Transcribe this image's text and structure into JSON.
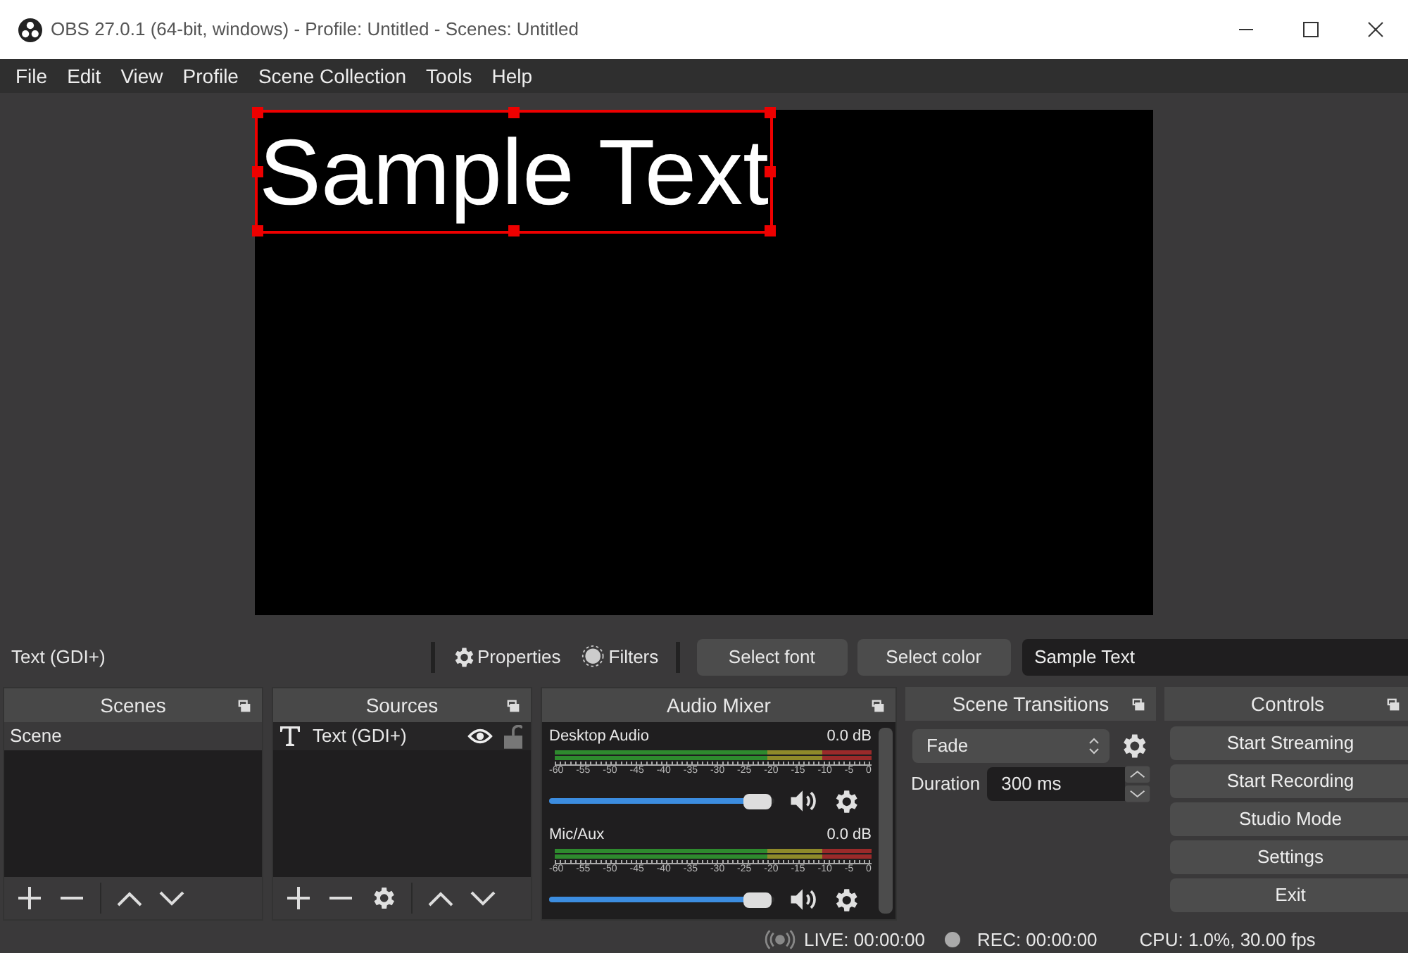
{
  "window": {
    "title": "OBS 27.0.1 (64-bit, windows) - Profile: Untitled - Scenes: Untitled"
  },
  "menu": [
    "File",
    "Edit",
    "View",
    "Profile",
    "Scene Collection",
    "Tools",
    "Help"
  ],
  "preview": {
    "text": "Sample Text",
    "selected": true
  },
  "source_toolbar": {
    "source_name": "Text (GDI+)",
    "properties": "Properties",
    "filters": "Filters",
    "select_font": "Select font",
    "select_color": "Select color",
    "text_value": "Sample Text"
  },
  "scenes": {
    "title": "Scenes",
    "items": [
      {
        "label": "Scene",
        "selected": true
      }
    ]
  },
  "sources": {
    "title": "Sources",
    "items": [
      {
        "label": "Text (GDI+)",
        "visible": true,
        "locked": false,
        "selected": false
      }
    ]
  },
  "audio_mixer": {
    "title": "Audio Mixer",
    "channels": [
      {
        "name": "Desktop Audio",
        "reading": "0.0 dB",
        "level": 0.95,
        "muted": false,
        "scale": [
          "-60",
          "-55",
          "-50",
          "-45",
          "-40",
          "-35",
          "-30",
          "-25",
          "-20",
          "-15",
          "-10",
          "-5",
          "0"
        ]
      },
      {
        "name": "Mic/Aux",
        "reading": "0.0 dB",
        "level": 0.95,
        "muted": false,
        "scale": [
          "-60",
          "-55",
          "-50",
          "-45",
          "-40",
          "-35",
          "-30",
          "-25",
          "-20",
          "-15",
          "-10",
          "-5",
          "0"
        ]
      }
    ]
  },
  "scene_transitions": {
    "title": "Scene Transitions",
    "transition": "Fade",
    "duration_label": "Duration",
    "duration": "300 ms"
  },
  "controls": {
    "title": "Controls",
    "buttons": [
      "Start Streaming",
      "Start Recording",
      "Studio Mode",
      "Settings",
      "Exit"
    ]
  },
  "status_bar": {
    "live": "LIVE: 00:00:00",
    "rec": "REC: 00:00:00",
    "cpu": "CPU: 1.0%, 30.00 fps"
  }
}
